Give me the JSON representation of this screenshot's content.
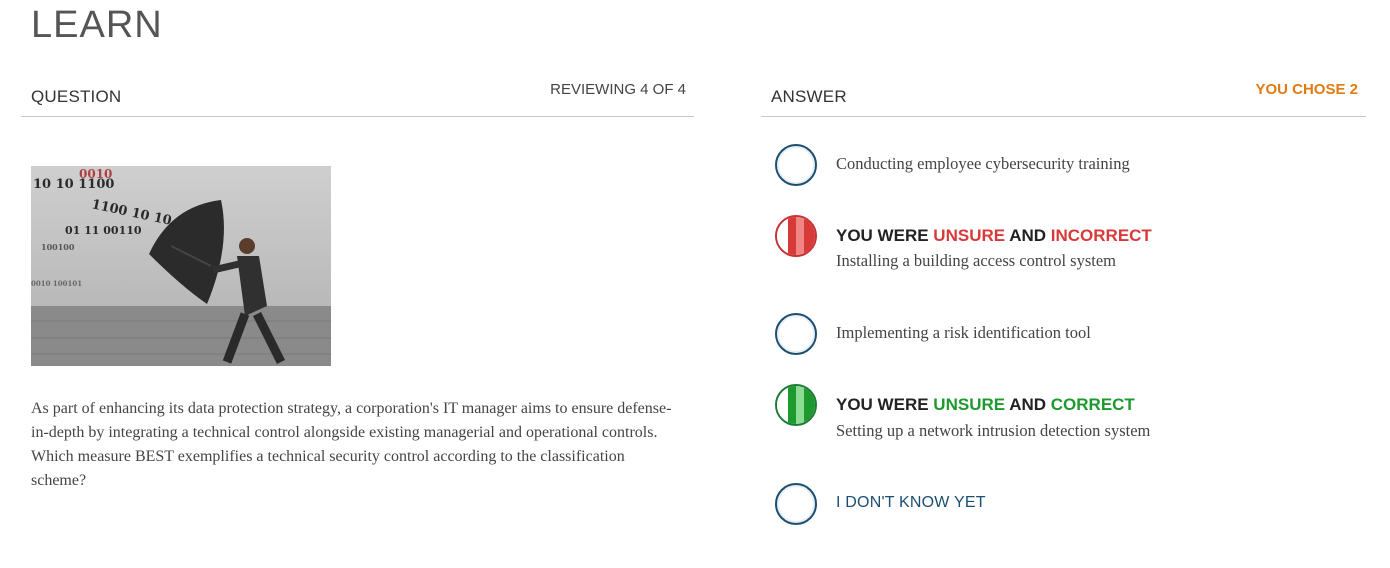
{
  "page": {
    "title": "LEARN"
  },
  "question_panel": {
    "header": "QUESTION",
    "progress": "REVIEWING 4 OF 4",
    "image": {
      "icon": "businessman-umbrella-binary-code-photo",
      "binary_lines": [
        "0010",
        "10 10 1100",
        "1100 10 10",
        "01 11 00110",
        "100100",
        "0010 100101"
      ]
    },
    "text": "As part of enhancing its data protection strategy, a corporation's IT manager aims to ensure defense-in-depth by integrating a technical control alongside existing managerial and operational controls. Which measure BEST exemplifies a technical security control according to the classification scheme?"
  },
  "answer_panel": {
    "header": "ANSWER",
    "chosen": "YOU CHOSE 2",
    "options": [
      {
        "text": "Conducting employee cybersecurity training"
      },
      {
        "status_prefix": "YOU WERE",
        "status_confidence": "UNSURE",
        "status_join": "AND",
        "status_result": "INCORRECT",
        "text": "Installing a building access control system"
      },
      {
        "text": "Implementing a risk identification tool"
      },
      {
        "status_prefix": "YOU WERE",
        "status_confidence": "UNSURE",
        "status_join": "AND",
        "status_result": "CORRECT",
        "text": "Setting up a network intrusion detection system"
      }
    ],
    "dont_know": "I DON'T KNOW YET"
  },
  "colors": {
    "accent_orange": "#e07b12",
    "incorrect_red": "#d83a3a",
    "correct_green": "#1d9a2e",
    "radio_blue": "#1b4f72"
  }
}
